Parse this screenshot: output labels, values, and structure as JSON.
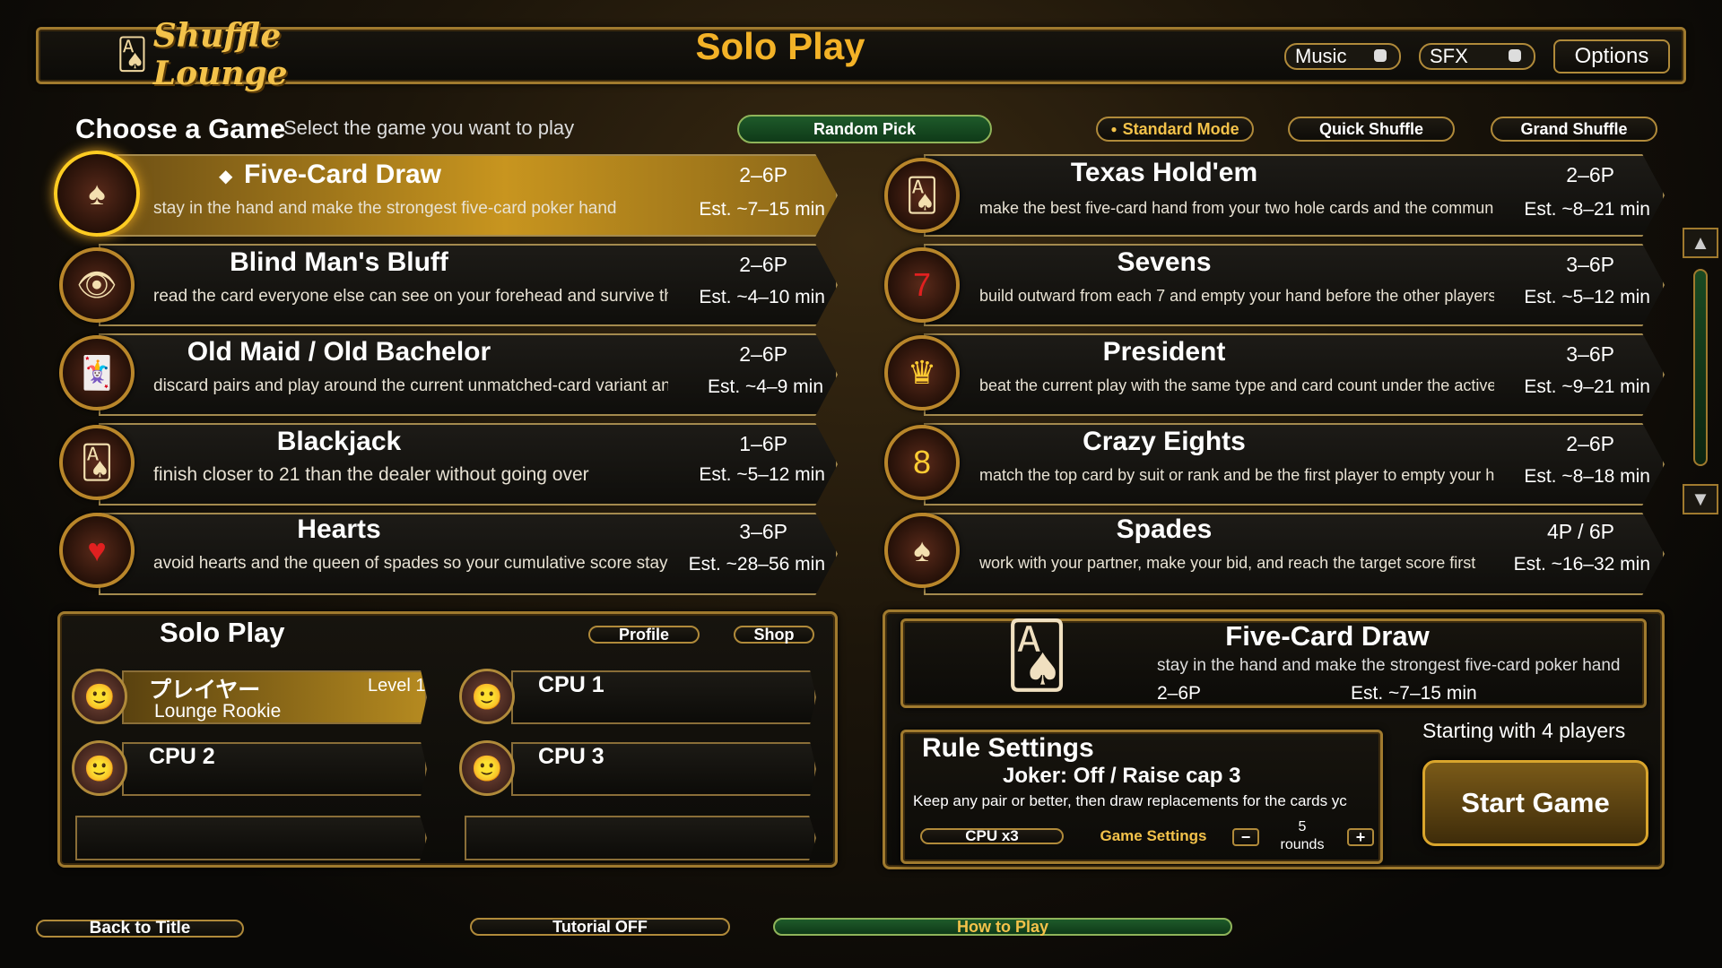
{
  "header": {
    "logo": "Shuffle Lounge",
    "title": "Solo Play",
    "music_label": "Music",
    "sfx_label": "SFX",
    "options_label": "Options"
  },
  "chooser": {
    "title": "Choose a Game",
    "subtitle": "Select the game you want to play",
    "random_label": "Random Pick",
    "modes": [
      "Standard Mode",
      "Quick Shuffle",
      "Grand Shuffle"
    ]
  },
  "games_left": [
    {
      "name": "Five-Card Draw",
      "desc": "stay in the hand and make the strongest five-card poker hand",
      "players": "2–6P",
      "time": "Est. ~7–15 min",
      "icon": "poker-chip-icon"
    },
    {
      "name": "Blind Man's Bluff",
      "desc": "read the card everyone else can see on your forehead and survive the b",
      "players": "2–6P",
      "time": "Est. ~4–10 min",
      "icon": "eye-card-icon"
    },
    {
      "name": "Old Maid / Old Bachelor",
      "desc": "discard pairs and play around the current unmatched-card variant and la",
      "players": "2–6P",
      "time": "Est. ~4–9 min",
      "icon": "jester-icon"
    },
    {
      "name": "Blackjack",
      "desc": "finish closer to 21 than the dealer without going over",
      "players": "1–6P",
      "time": "Est. ~5–12 min",
      "icon": "cards-icon"
    },
    {
      "name": "Hearts",
      "desc": "avoid hearts and the queen of spades so your cumulative score stays as",
      "players": "3–6P",
      "time": "Est. ~28–56 min",
      "icon": "heart-icon"
    }
  ],
  "games_right": [
    {
      "name": "Texas Hold'em",
      "desc": "make the best five-card hand from your two hole cards and the commun",
      "players": "2–6P",
      "time": "Est. ~8–21 min",
      "icon": "cards-icon"
    },
    {
      "name": "Sevens",
      "desc": "build outward from each 7 and empty your hand before the other players",
      "players": "3–6P",
      "time": "Est. ~5–12 min",
      "icon": "seven-icon"
    },
    {
      "name": "President",
      "desc": "beat the current play with the same type and card count under the active",
      "players": "3–6P",
      "time": "Est. ~9–21 min",
      "icon": "crown-icon"
    },
    {
      "name": "Crazy Eights",
      "desc": "match the top card by suit or rank and be the first player to empty your h",
      "players": "2–6P",
      "time": "Est. ~8–18 min",
      "icon": "eight-icon"
    },
    {
      "name": "Spades",
      "desc": "work with your partner, make your bid, and reach the target score first",
      "players": "4P / 6P",
      "time": "Est. ~16–32 min",
      "icon": "spade-icon"
    }
  ],
  "selected_marker": "◆",
  "solo": {
    "title": "Solo Play",
    "profile_label": "Profile",
    "shop_label": "Shop",
    "player": {
      "name": "プレイヤー",
      "level": "Level 1",
      "rank": "Lounge Rookie"
    },
    "cpus": [
      "CPU 1",
      "CPU 2",
      "CPU 3"
    ]
  },
  "detail": {
    "name": "Five-Card Draw",
    "desc": "stay in the hand and make the strongest five-card poker hand",
    "players": "2–6P",
    "time": "Est. ~7–15 min",
    "starting": "Starting with 4 players"
  },
  "rules": {
    "title": "Rule Settings",
    "summary": "Joker: Off / Raise cap 3",
    "desc": "Keep any pair or better, then draw replacements for the cards yc",
    "cpu_label": "CPU x3",
    "settings_label": "Game Settings",
    "rounds_value": "5",
    "rounds_unit": "rounds",
    "minus": "−",
    "plus": "+"
  },
  "start_label": "Start Game",
  "footer": {
    "back_label": "Back to Title",
    "tutorial_label": "Tutorial OFF",
    "howto_label": "How to Play"
  },
  "scroll": {
    "up": "▲",
    "down": "▼"
  }
}
